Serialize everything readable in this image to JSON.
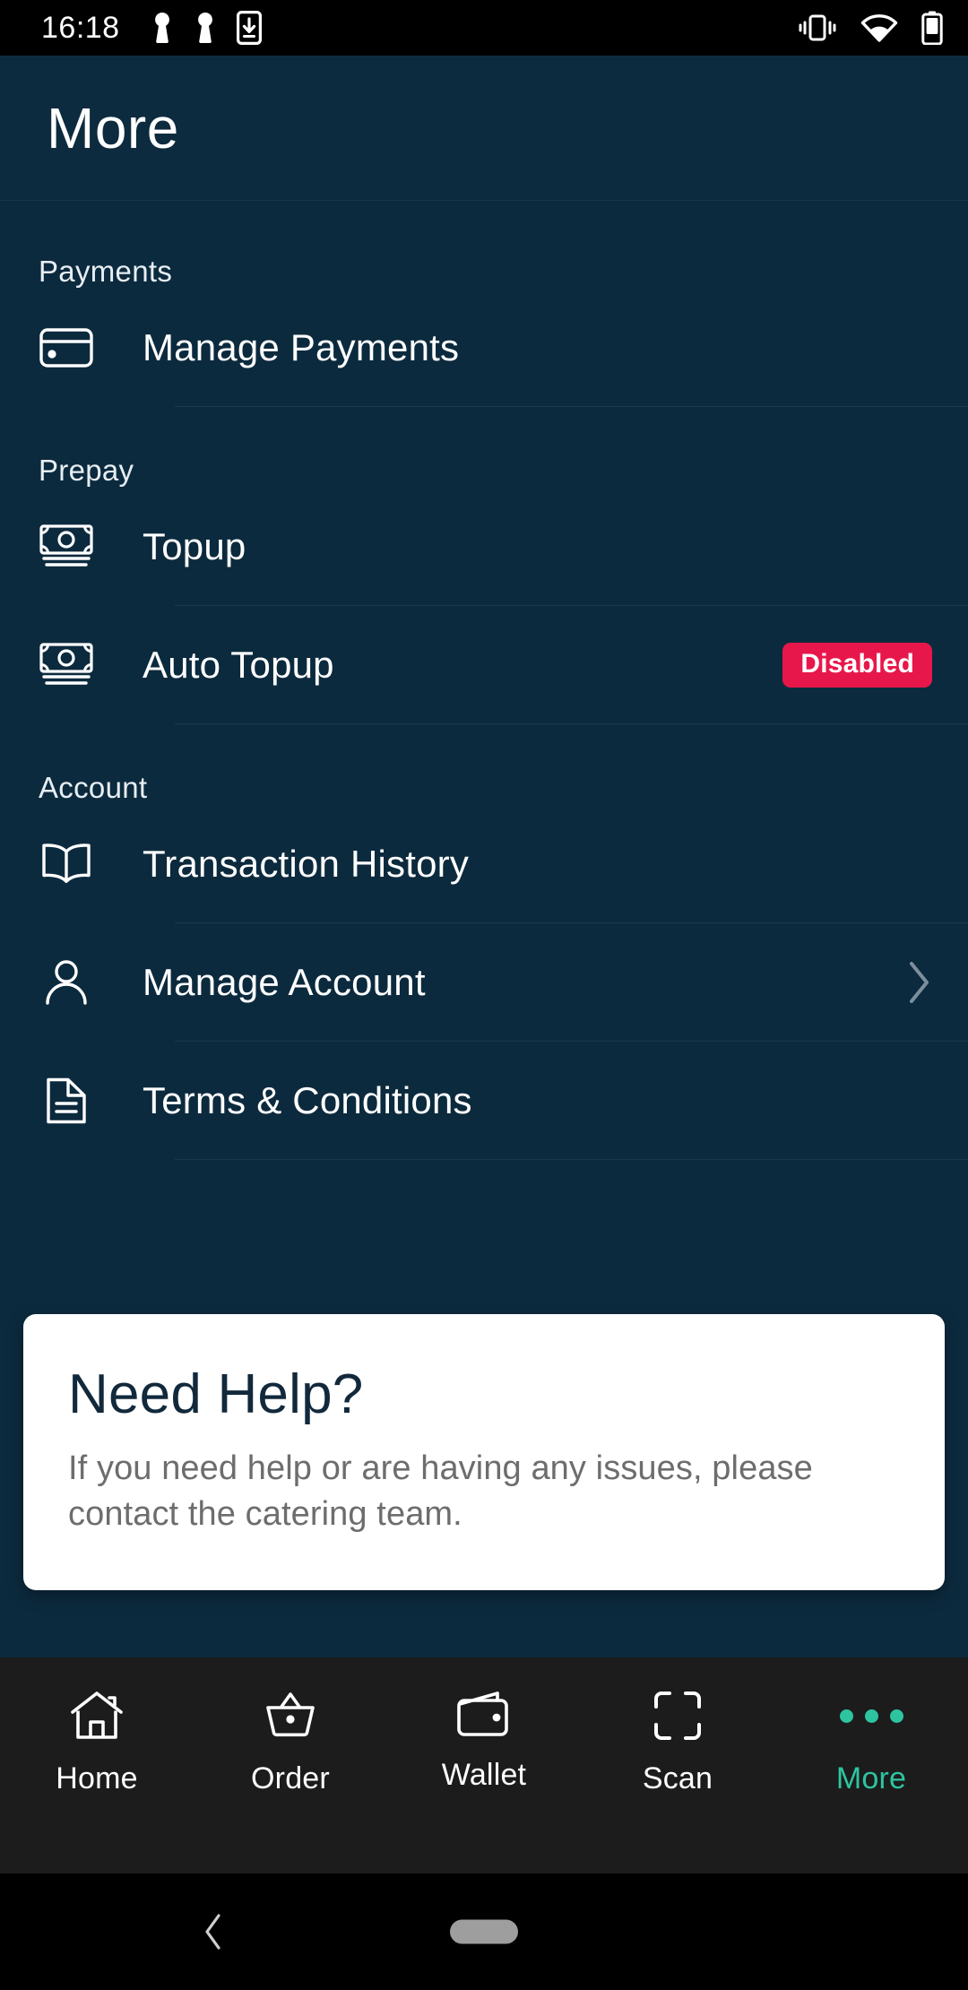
{
  "status_bar": {
    "time": "16:18",
    "left_icons": [
      "vpn-key-icon",
      "vpn-key-icon",
      "download-to-phone-icon"
    ],
    "right_icons": [
      "vibrate-icon",
      "wifi-icon",
      "battery-icon"
    ]
  },
  "header": {
    "title": "More"
  },
  "sections": [
    {
      "label": "Payments",
      "rows": [
        {
          "icon": "credit-card-icon",
          "label": "Manage Payments",
          "badge": null,
          "chevron": false,
          "divider": true
        }
      ]
    },
    {
      "label": "Prepay",
      "rows": [
        {
          "icon": "banknotes-icon",
          "label": "Topup",
          "badge": null,
          "chevron": false,
          "divider": true
        },
        {
          "icon": "banknotes-icon",
          "label": "Auto Topup",
          "badge": "Disabled",
          "chevron": false,
          "divider": true
        }
      ]
    },
    {
      "label": "Account",
      "rows": [
        {
          "icon": "open-book-icon",
          "label": "Transaction History",
          "badge": null,
          "chevron": false,
          "divider": true
        },
        {
          "icon": "person-icon",
          "label": "Manage Account",
          "badge": null,
          "chevron": true,
          "divider": true
        },
        {
          "icon": "document-icon",
          "label": "Terms & Conditions",
          "badge": null,
          "chevron": false,
          "divider": true
        }
      ]
    }
  ],
  "help_card": {
    "title": "Need Help?",
    "body": "If you need help or are having any issues, please contact the catering team."
  },
  "bottom_nav": {
    "items": [
      {
        "icon": "home-icon",
        "label": "Home",
        "active": false
      },
      {
        "icon": "basket-icon",
        "label": "Order",
        "active": false
      },
      {
        "icon": "wallet-icon",
        "label": "Wallet",
        "active": false
      },
      {
        "icon": "scan-icon",
        "label": "Scan",
        "active": false
      },
      {
        "icon": "more-dots-icon",
        "label": "More",
        "active": true
      }
    ]
  },
  "gesture_bar": {
    "back_icon": "back-chevron-icon",
    "home_icon": "home-pill-indicator"
  },
  "colors": {
    "background": "#0c2a3e",
    "appbar": "#0d2b3f",
    "badge": "#e8174b",
    "accent": "#2ec4a0",
    "card": "#ffffff",
    "nav_background": "#1c1c1c",
    "divider": "#17394d"
  }
}
